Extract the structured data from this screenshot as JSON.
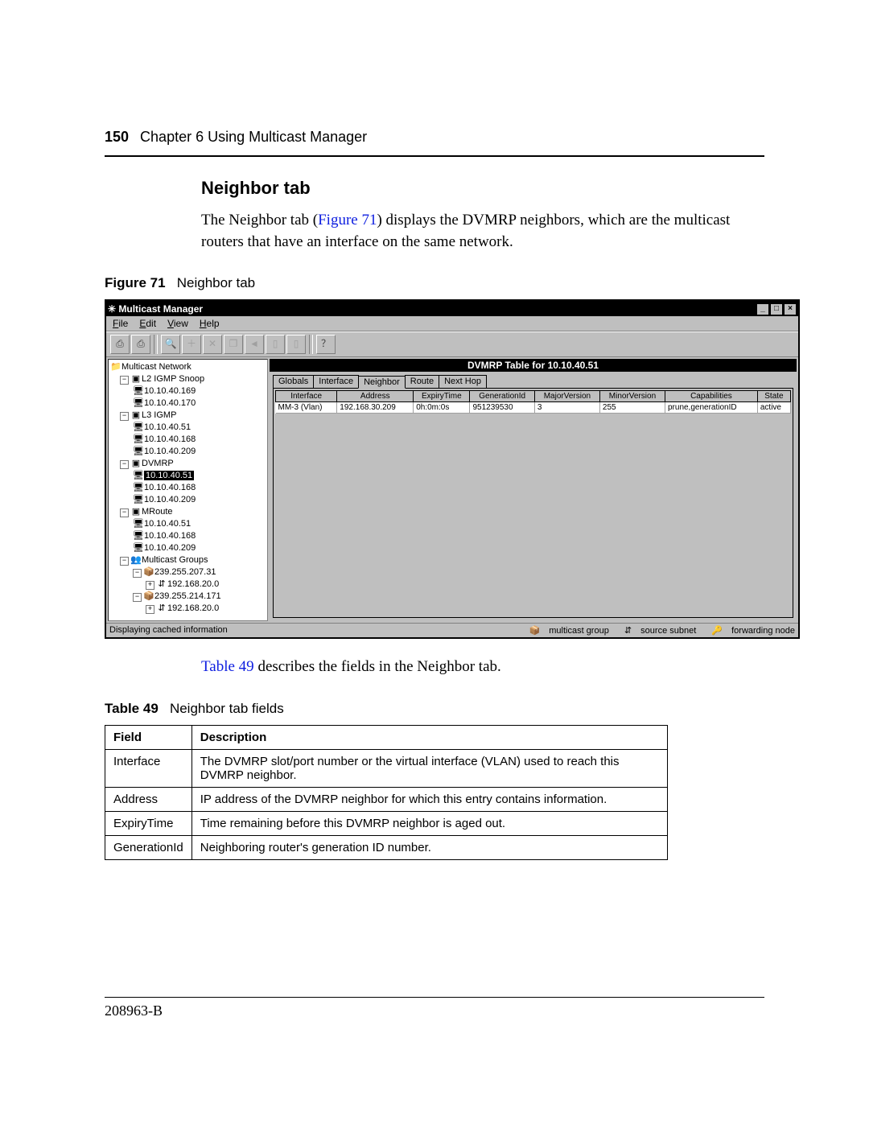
{
  "header": {
    "page_number": "150",
    "chapter": "Chapter 6  Using Multicast Manager"
  },
  "section": {
    "title": "Neighbor tab",
    "intro_before": "The Neighbor tab (",
    "intro_link": "Figure 71",
    "intro_after": ") displays the DVMRP neighbors, which are the multicast routers that have an interface on the same network."
  },
  "figure": {
    "label": "Figure 71",
    "caption": "Neighbor tab",
    "window_title": "Multicast Manager",
    "menus": [
      "File",
      "Edit",
      "View",
      "Help"
    ],
    "pane_title": "DVMRP Table for 10.10.40.51",
    "tabs": [
      "Globals",
      "Interface",
      "Neighbor",
      "Route",
      "Next Hop"
    ],
    "grid_headers": [
      "Interface",
      "Address",
      "ExpiryTime",
      "GenerationId",
      "MajorVersion",
      "MinorVersion",
      "Capabilities",
      "State"
    ],
    "grid_row": [
      "MM-3 (Vlan)",
      "192.168.30.209",
      "0h:0m:0s",
      "951239530",
      "3",
      "255",
      "prune,generationID",
      "active"
    ],
    "tree": {
      "root": "Multicast Network",
      "groups": [
        {
          "label": "L2 IGMP Snoop",
          "children": [
            "10.10.40.169",
            "10.10.40.170"
          ]
        },
        {
          "label": "L3 IGMP",
          "children": [
            "10.10.40.51",
            "10.10.40.168",
            "10.10.40.209"
          ]
        },
        {
          "label": "DVMRP",
          "children": [
            "10.10.40.51",
            "10.10.40.168",
            "10.10.40.209"
          ],
          "selected": 0
        },
        {
          "label": "MRoute",
          "children": [
            "10.10.40.51",
            "10.10.40.168",
            "10.10.40.209"
          ]
        },
        {
          "label": "Multicast Groups",
          "mc": [
            {
              "ip": "239.255.207.31",
              "sub": "192.168.20.0"
            },
            {
              "ip": "239.255.214.171",
              "sub": "192.168.20.0"
            }
          ]
        }
      ]
    },
    "status_left": "Displaying cached information",
    "legend": {
      "a": "multicast group",
      "b": "source subnet",
      "c": "forwarding node"
    }
  },
  "after_figure": {
    "before": "",
    "link": "Table 49",
    "after": " describes the fields in the Neighbor tab."
  },
  "table": {
    "label": "Table 49",
    "caption": "Neighbor tab fields",
    "head": [
      "Field",
      "Description"
    ],
    "rows": [
      [
        "Interface",
        "The DVMRP slot/port number or the virtual interface (VLAN) used to reach this DVMRP neighbor."
      ],
      [
        "Address",
        "IP address of the DVMRP neighbor for which this entry contains information."
      ],
      [
        "ExpiryTime",
        "Time remaining before this DVMRP neighbor is aged out."
      ],
      [
        "GenerationId",
        "Neighboring router's generation ID number."
      ]
    ]
  },
  "footer": {
    "docnum": "208963-B"
  }
}
